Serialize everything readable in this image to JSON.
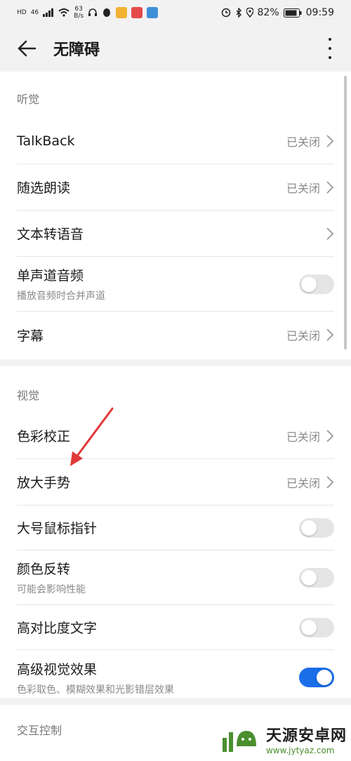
{
  "status_bar": {
    "left_icons": [
      "hd-icon",
      "signal-4g-icon",
      "wifi-icon"
    ],
    "speed_value": "63",
    "speed_unit": "B/s",
    "network": "46",
    "battery": "82%",
    "time": "09:59"
  },
  "header": {
    "title": "无障碍"
  },
  "sections": [
    {
      "title": "听觉",
      "items": [
        {
          "label": "TalkBack",
          "status": "已关闭"
        },
        {
          "label": "随选朗读",
          "status": "已关闭"
        },
        {
          "label": "文本转语音"
        },
        {
          "label": "单声道音频",
          "sub": "播放音频时合并声道",
          "toggle": false
        },
        {
          "label": "字幕",
          "status": "已关闭"
        }
      ]
    },
    {
      "title": "视觉",
      "items": [
        {
          "label": "色彩校正",
          "status": "已关闭"
        },
        {
          "label": "放大手势",
          "status": "已关闭"
        },
        {
          "label": "大号鼠标指针",
          "toggle": false
        },
        {
          "label": "颜色反转",
          "sub": "可能会影响性能",
          "toggle": false
        },
        {
          "label": "高对比度文字",
          "toggle": false
        },
        {
          "label": "高级视觉效果",
          "sub": "色彩取色、模糊效果和光影错层效果",
          "toggle": true
        }
      ]
    },
    {
      "title": "交互控制"
    }
  ],
  "colors": {
    "accent": "#1a6ee8",
    "arrow": "#e03a3a"
  },
  "watermark": {
    "title": "天源安卓网",
    "url": "www.jytyaz.com"
  }
}
